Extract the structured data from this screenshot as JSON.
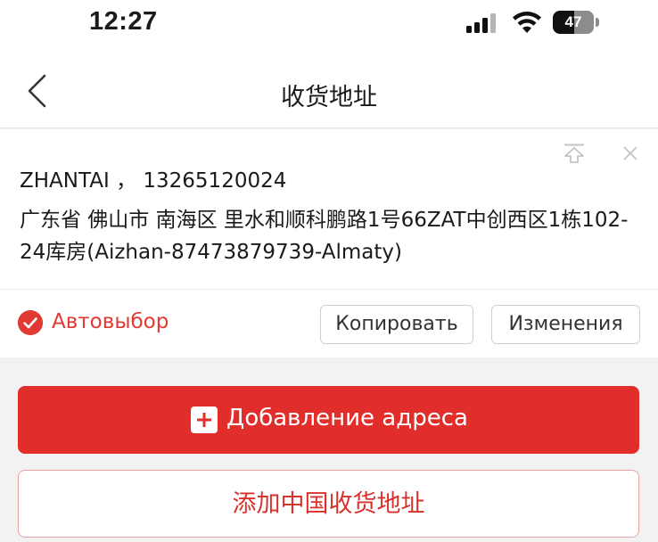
{
  "status_bar": {
    "time": "12:27",
    "battery": "47"
  },
  "nav": {
    "title": "收货地址"
  },
  "address_card": {
    "recipient": "ZHANTAI ， 13265120024",
    "address": "广东省 佛山市 南海区 里水和顺科鹏路1号66ZAT中创西区1栋102-24库房(Aizhan-87473879739-Almaty)",
    "default_label": "Автовыбор",
    "copy_label": "Копировать",
    "edit_label": "Изменения"
  },
  "actions": {
    "add_address_label": "Добавление адреса",
    "add_china_address_label": "添加中国收货地址"
  },
  "colors": {
    "accent": "#e12e2b",
    "default_red": "#e03a32"
  },
  "icons": {
    "back": "chevron-left-icon",
    "pin_top": "pin-to-top-icon",
    "close": "close-icon",
    "check": "check-circle-icon",
    "add": "plus-square-icon"
  }
}
